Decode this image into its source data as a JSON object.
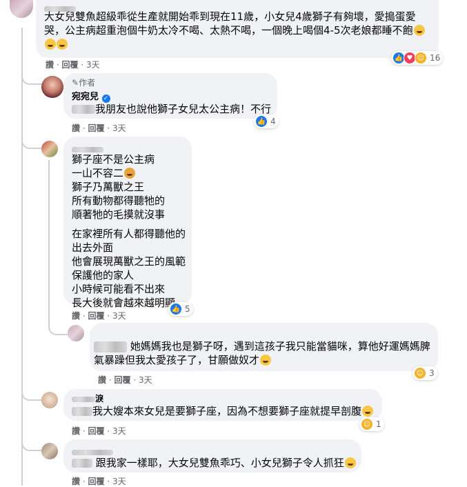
{
  "comments": [
    {
      "id": "c1",
      "lines": [
        "大女兒雙魚超級乖從生產就開始乖到現在11歲，小女兒4歲獅子有夠壞，愛搗蛋愛",
        "哭，公主病超重泡個牛奶太冷不喝、太熱不喝，一個晚上喝個4-5次老娘都睡不飽"
      ],
      "reactions": {
        "icons": [
          "like-icon",
          "love-icon",
          "haha-icon"
        ],
        "count": "16"
      },
      "meta": {
        "like": "讚",
        "reply": "回覆",
        "time": "3天"
      }
    },
    {
      "id": "c2",
      "author_badge": "作者",
      "author": "宛宛兒",
      "text": "我朋友也說他獅子女兒太公主病！不行",
      "reactions": {
        "icons": [
          "like-icon"
        ],
        "count": "4"
      },
      "meta": {
        "like": "讚",
        "reply": "回覆",
        "time": "3天"
      }
    },
    {
      "id": "c3",
      "lines_a": [
        "獅子座不是公主病",
        "一山不容二",
        "獅子乃萬獸之王",
        "所有動物都得聽牠的",
        "順著牠的毛摸就沒事"
      ],
      "lines_b": [
        "在家裡所有人都得聽他的",
        "出去外面",
        "他會展現萬獸之王的風範",
        "保護他的家人",
        "小時候可能看不出來",
        "長大後就會越來越明顯"
      ],
      "reactions": {
        "icons": [
          "like-icon"
        ],
        "count": "5"
      },
      "meta": {
        "like": "讚",
        "reply": "回覆",
        "time": "3天"
      }
    },
    {
      "id": "c4",
      "lines": [
        "她媽媽我也是獅子呀，遇到這孩子我只能當貓咪，算他好運媽媽脾",
        "氣暴躁但我太愛孩子了，甘願做奴才"
      ],
      "reactions": {
        "icons": [
          "haha-icon"
        ],
        "count": "3"
      },
      "meta": {
        "like": "讚",
        "reply": "回覆",
        "time": "3天"
      }
    },
    {
      "id": "c5",
      "name_suffix": "淚",
      "text": "我大嫂本來女兒是要獅子座，因為不想要獅子座就提早剖腹",
      "reactions": {
        "icons": [
          "haha-icon"
        ],
        "count": "1"
      },
      "meta": {
        "like": "讚",
        "reply": "回覆",
        "time": "3天"
      }
    },
    {
      "id": "c6",
      "text": "跟我家一樣耶，大女兒雙魚乖巧、小女兒獅子令人抓狂",
      "meta": {
        "like": "讚",
        "reply": "回覆",
        "time": "3天"
      }
    }
  ]
}
